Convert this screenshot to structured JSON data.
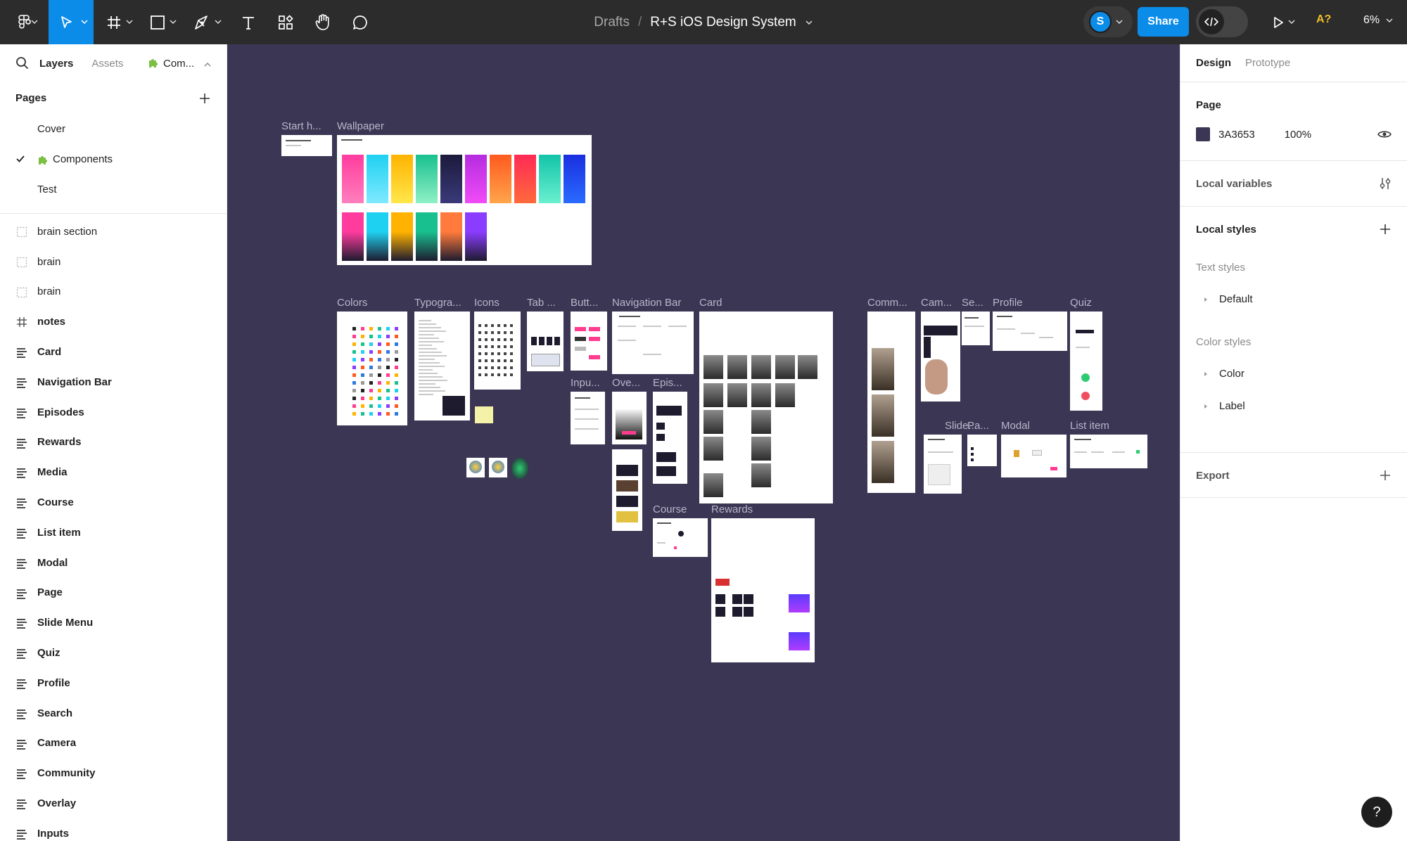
{
  "toolbar": {
    "breadcrumb_drafts": "Drafts",
    "breadcrumb_sep": "/",
    "file_name": "R+S iOS Design System",
    "avatar_initial": "S",
    "share_label": "Share",
    "ai_label": "A?",
    "zoom_label": "6%"
  },
  "left_panel": {
    "tab_layers": "Layers",
    "tab_assets": "Assets",
    "tab_components": "Com...",
    "pages_title": "Pages",
    "pages": [
      {
        "label": "Cover"
      },
      {
        "label": "Components",
        "selected": true
      },
      {
        "label": "Test"
      }
    ],
    "layers": [
      {
        "label": "brain section",
        "kind": "section"
      },
      {
        "label": "brain",
        "kind": "section"
      },
      {
        "label": "brain",
        "kind": "section"
      },
      {
        "label": "notes",
        "kind": "frame"
      },
      {
        "label": "Card",
        "kind": "component"
      },
      {
        "label": "Navigation Bar",
        "kind": "component"
      },
      {
        "label": "Episodes",
        "kind": "component"
      },
      {
        "label": "Rewards",
        "kind": "component"
      },
      {
        "label": "Media",
        "kind": "component"
      },
      {
        "label": "Course",
        "kind": "component"
      },
      {
        "label": "List item",
        "kind": "component"
      },
      {
        "label": "Modal",
        "kind": "component"
      },
      {
        "label": "Page",
        "kind": "component"
      },
      {
        "label": "Slide Menu",
        "kind": "component"
      },
      {
        "label": "Quiz",
        "kind": "component"
      },
      {
        "label": "Profile",
        "kind": "component"
      },
      {
        "label": "Search",
        "kind": "component"
      },
      {
        "label": "Camera",
        "kind": "component"
      },
      {
        "label": "Community",
        "kind": "component"
      },
      {
        "label": "Overlay",
        "kind": "component"
      },
      {
        "label": "Inputs",
        "kind": "component"
      }
    ]
  },
  "canvas": {
    "labels": {
      "start": "Start h...",
      "wallpaper": "Wallpaper",
      "colors": "Colors",
      "typography": "Typogra...",
      "icons": "Icons",
      "tab": "Tab ...",
      "buttons": "Butt...",
      "navbar": "Navigation Bar",
      "card": "Card",
      "community": "Comm...",
      "camera": "Cam...",
      "search": "Se...",
      "profile": "Profile",
      "quiz": "Quiz",
      "inputs": "Inpu...",
      "overlay": "Ove...",
      "episodes": "Epis...",
      "slide": "Slide...",
      "page": "Pa...",
      "modal": "Modal",
      "listitem": "List item",
      "course": "Course",
      "rewards": "Rewards"
    },
    "wallpaper_colors": [
      [
        "#ff3c9e",
        "#ff7fbd"
      ],
      [
        "#1fd1f0",
        "#7fe9ff"
      ],
      [
        "#ffb300",
        "#ffe74a"
      ],
      [
        "#19c08f",
        "#8ff0c6"
      ],
      [
        "#1c1a3c",
        "#3a3a7a"
      ],
      [
        "#b52ce0",
        "#f04cf7"
      ],
      [
        "#ff5a1f",
        "#ffa54a"
      ],
      [
        "#ff2a55",
        "#ff6a3c"
      ],
      [
        "#12c4a8",
        "#6af0d0"
      ],
      [
        "#1a2fe0",
        "#2a6bff"
      ]
    ],
    "wallpaper_row2_colors": [
      "#ff3c9e",
      "#1fd1f0",
      "#ffb300",
      "#19c08f",
      "#ff7a3c",
      "#8a3cff"
    ]
  },
  "right_panel": {
    "tab_design": "Design",
    "tab_prototype": "Prototype",
    "page_title": "Page",
    "page_color_hex": "3A3653",
    "page_color": "#3a3653",
    "page_opacity": "100%",
    "local_variables": "Local variables",
    "local_styles": "Local styles",
    "text_styles": "Text styles",
    "text_style_items": [
      "Default"
    ],
    "color_styles": "Color styles",
    "color_style_items": [
      "Color",
      "Label"
    ],
    "export": "Export"
  },
  "help_label": "?"
}
